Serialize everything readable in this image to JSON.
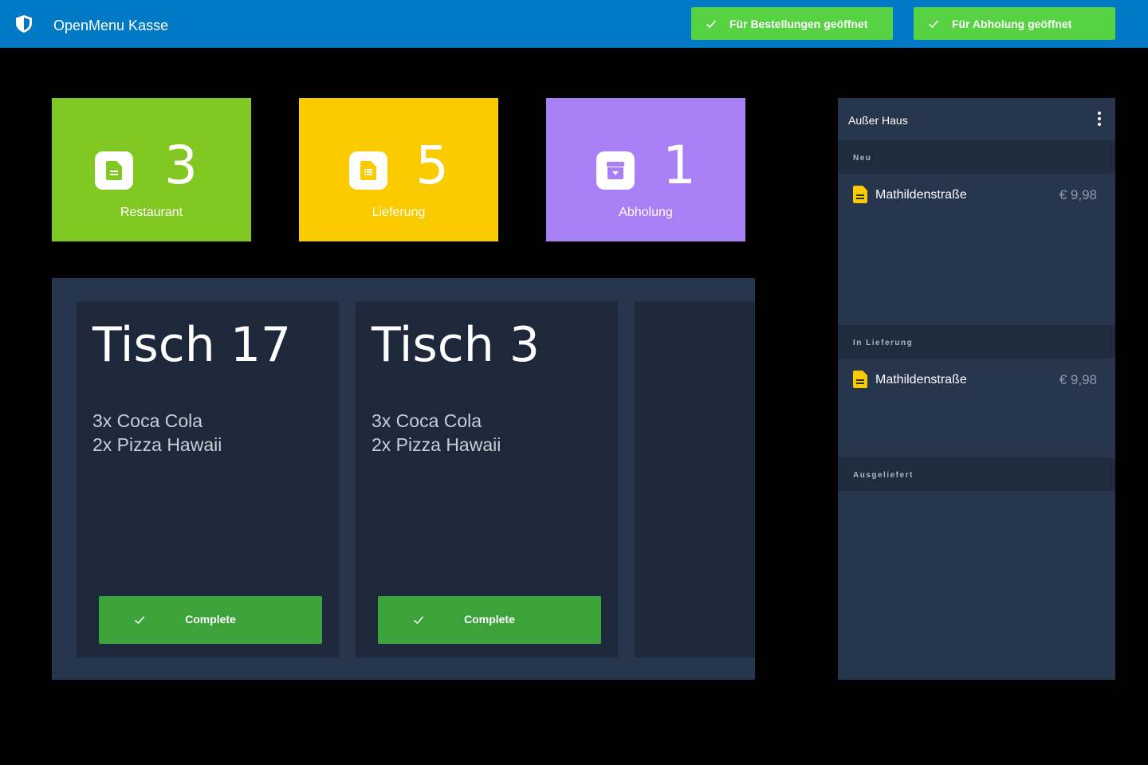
{
  "header": {
    "title": "OpenMenu Kasse",
    "logo_icon": "shield-icon",
    "status_buttons": [
      {
        "label": "Für Bestellungen geöffnet",
        "icon": "check-icon",
        "color": "#56d243"
      },
      {
        "label": "Für Abholung geöffnet",
        "icon": "check-icon",
        "color": "#56d243"
      }
    ]
  },
  "summary": [
    {
      "label": "Restaurant",
      "count": "3",
      "icon": "document-icon",
      "color": "#82c823"
    },
    {
      "label": "Lieferung",
      "count": "5",
      "icon": "list-document-icon",
      "color": "#facc00"
    },
    {
      "label": "Abholung",
      "count": "1",
      "icon": "archive-icon",
      "color": "#a97ff5"
    }
  ],
  "orders": [
    {
      "table": "Tisch 17",
      "items": [
        "3x Coca Cola",
        "2x Pizza Hawaii"
      ],
      "action": "Complete"
    },
    {
      "table": "Tisch 3",
      "items": [
        "3x Coca Cola",
        "2x Pizza Hawaii"
      ],
      "action": "Complete"
    }
  ],
  "panel": {
    "title": "Außer Haus",
    "sections": [
      {
        "heading": "Neu",
        "orders": [
          {
            "address": "Mathildenstraße",
            "price": "€ 9,98",
            "icon": "document-icon"
          }
        ]
      },
      {
        "heading": "In Lieferung",
        "orders": [
          {
            "address": "Mathildenstraße",
            "price": "€ 9,98",
            "icon": "document-icon"
          }
        ]
      },
      {
        "heading": "Ausgeliefert",
        "orders": []
      }
    ]
  },
  "colors": {
    "header_bg": "#0179c4",
    "board_bg": "#27364d",
    "card_bg": "#1d283b",
    "complete_green": "#3ba33a"
  }
}
